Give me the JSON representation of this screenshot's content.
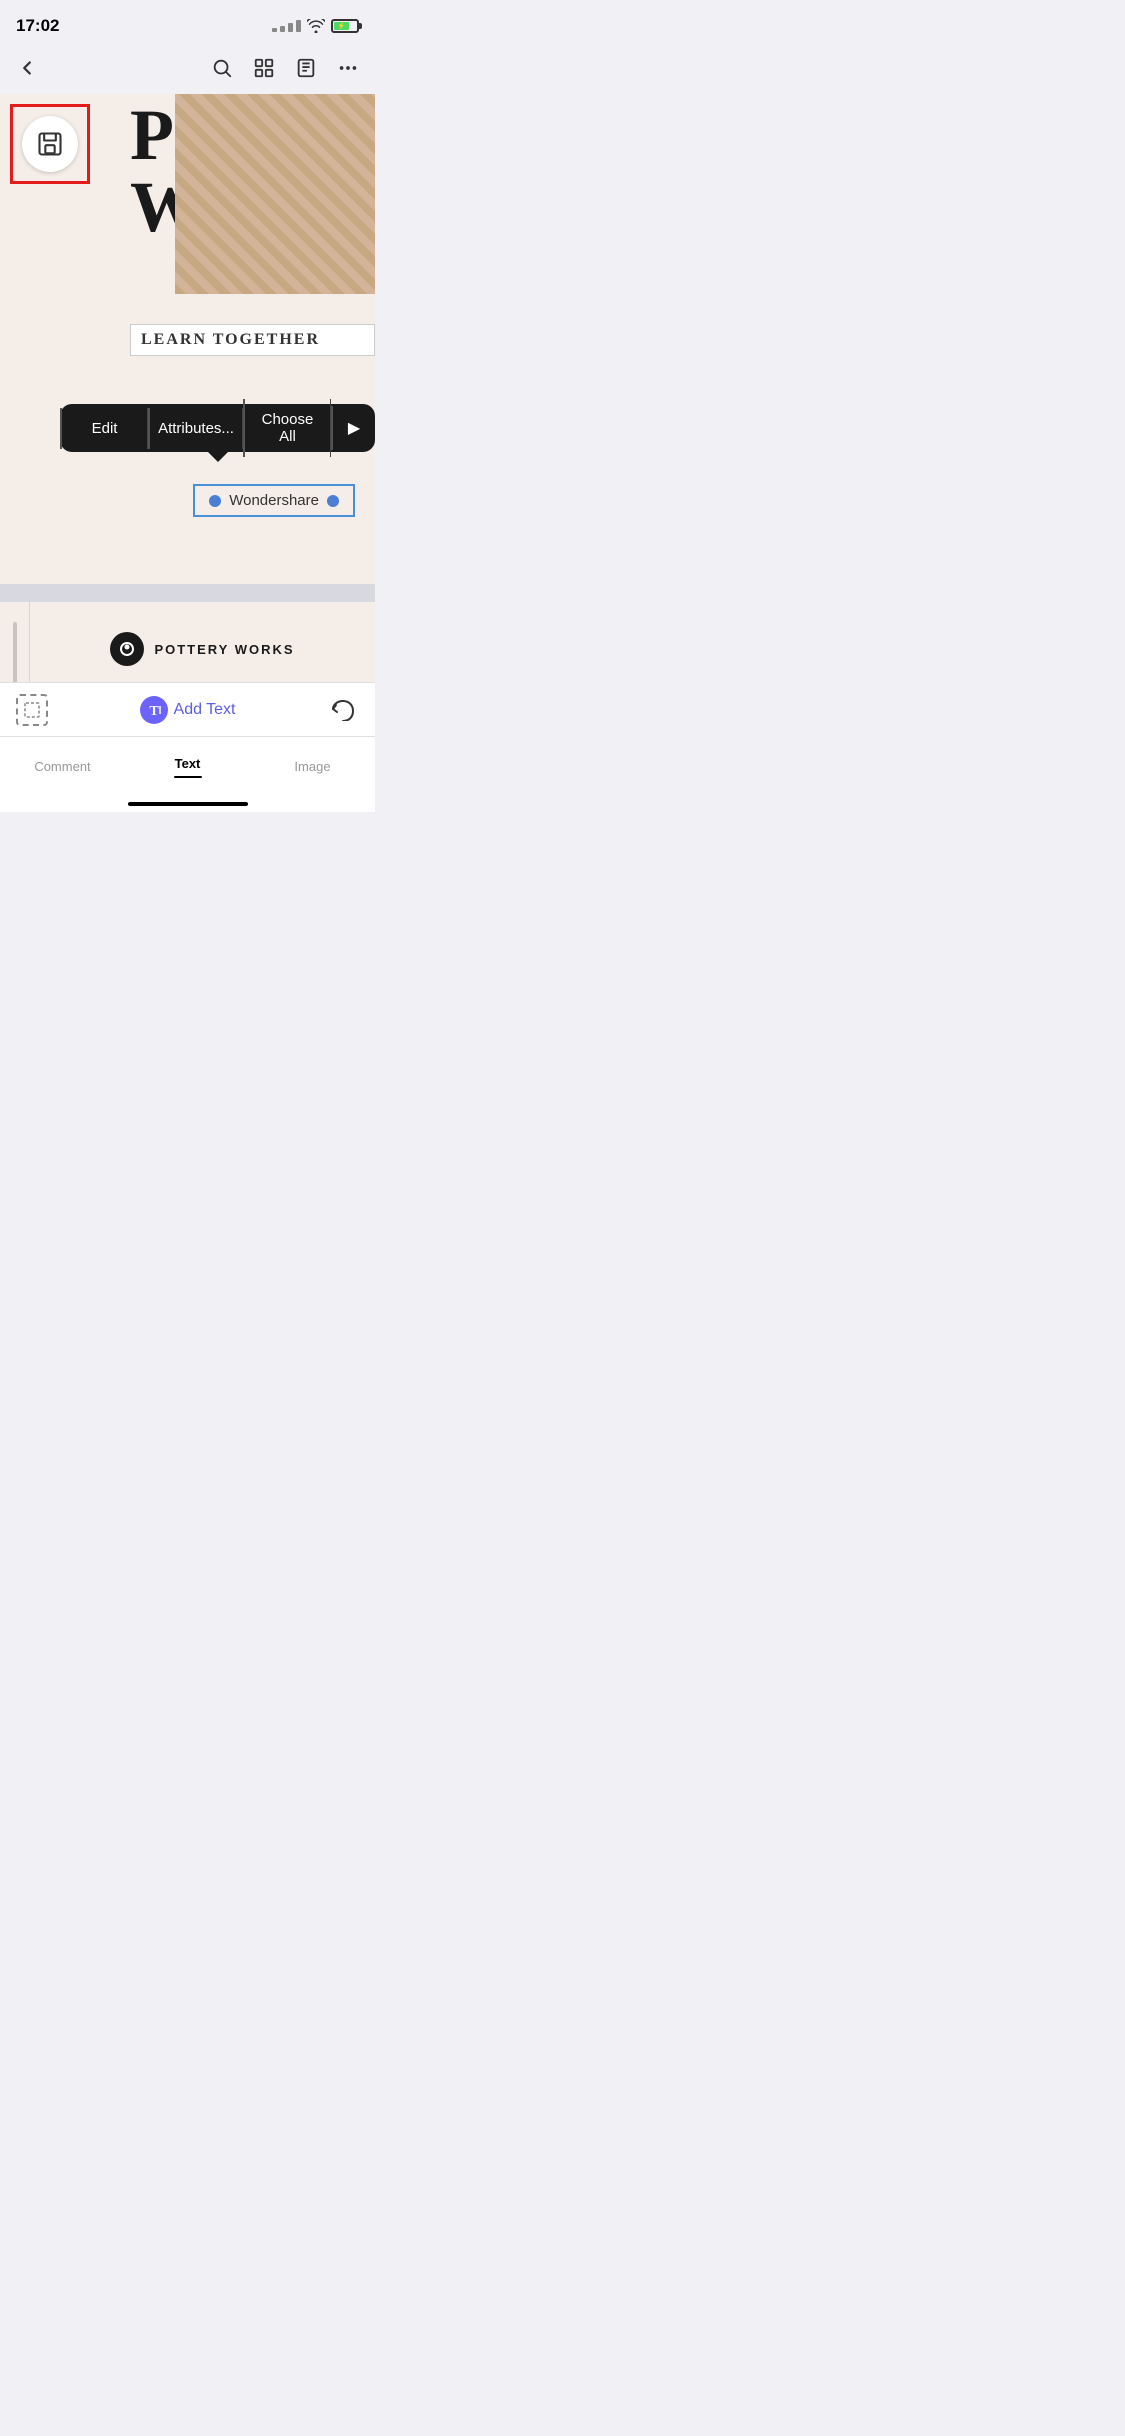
{
  "statusBar": {
    "time": "17:02"
  },
  "navbar": {
    "backLabel": "←",
    "searchLabel": "search",
    "gridLabel": "grid",
    "listLabel": "list",
    "moreLabel": "more"
  },
  "canvas": {
    "titleLine1": "Pottery",
    "titleLine2": "Workshop",
    "learnTogether": "LEARN TOGETHER",
    "saveButtonAlt": "save"
  },
  "contextMenu": {
    "editLabel": "Edit",
    "attributesLabel": "Attributes...",
    "chooseAllLabel": "Choose All",
    "arrowLabel": "▶"
  },
  "wondershare": {
    "text": "Wondershare"
  },
  "page2": {
    "potteryBrand": "POTTERY WORKS"
  },
  "bottomToolbar": {
    "addTextLabel": "Add Text",
    "undoLabel": "↩"
  },
  "tabs": {
    "comment": "Comment",
    "text": "Text",
    "image": "Image"
  }
}
